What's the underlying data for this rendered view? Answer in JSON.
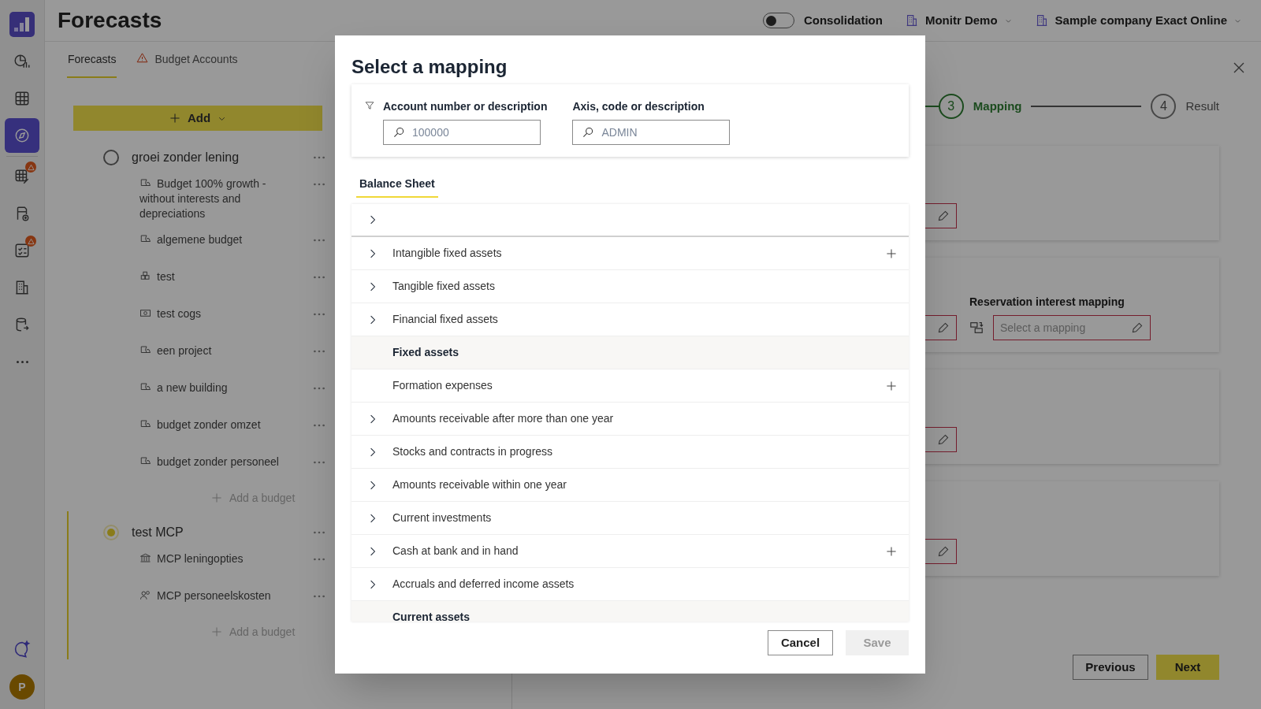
{
  "nav": {
    "items": [
      {
        "kind": "logo",
        "selected": false,
        "badge": false
      },
      {
        "kind": "chart",
        "selected": false,
        "badge": false
      },
      {
        "kind": "grid",
        "selected": false,
        "badge": false
      },
      {
        "kind": "compass",
        "selected": true,
        "badge": false
      },
      {
        "kind": "grid-edit",
        "selected": false,
        "badge": true
      },
      {
        "kind": "doc-add",
        "selected": false,
        "badge": false
      },
      {
        "kind": "checklist",
        "selected": false,
        "badge": true
      },
      {
        "kind": "building",
        "selected": false,
        "badge": false
      },
      {
        "kind": "database",
        "selected": false,
        "badge": false
      },
      {
        "kind": "more",
        "selected": false,
        "badge": false
      }
    ],
    "chat": true,
    "avatar": "P"
  },
  "page_title": "Forecasts",
  "header": {
    "consolidation": {
      "label": "Consolidation",
      "on": false
    },
    "environment": "Monitr Demo",
    "company": "Sample company Exact Online"
  },
  "tabs": [
    {
      "label": "Forecasts",
      "selected": true,
      "warning": false
    },
    {
      "label": "Budget Accounts",
      "selected": false,
      "warning": true
    }
  ],
  "add_button": "Add",
  "scenarios": [
    {
      "name": "groei zonder lening",
      "selected": false,
      "budgets": [
        {
          "name": "Budget 100% growth - without interests and depreciations",
          "kind": "scenario"
        },
        {
          "name": "algemene budget",
          "kind": "scenario"
        },
        {
          "name": "test",
          "kind": "blocks"
        },
        {
          "name": "test cogs",
          "kind": "cash"
        },
        {
          "name": "een project",
          "kind": "scenario"
        },
        {
          "name": "a new building",
          "kind": "scenario"
        },
        {
          "name": "budget zonder omzet",
          "kind": "scenario"
        },
        {
          "name": "budget zonder personeel",
          "kind": "scenario"
        }
      ],
      "add_label": "Add a budget"
    },
    {
      "name": "test MCP",
      "selected": true,
      "budgets": [
        {
          "name": "MCP leningopties",
          "kind": "bank"
        },
        {
          "name": "MCP personeelskosten",
          "kind": "people"
        }
      ],
      "add_label": "Add a budget"
    }
  ],
  "wizard": {
    "steps": [
      {
        "number": "3",
        "label": "Mapping",
        "active": true
      },
      {
        "number": "4",
        "label": "Result",
        "active": false
      }
    ],
    "cards": [
      {
        "kind": "single"
      },
      {
        "kind": "double",
        "label": "Reservation interest mapping",
        "placeholder": "Select a mapping"
      },
      {
        "kind": "single"
      },
      {
        "kind": "single"
      }
    ],
    "previous": "Previous",
    "next": "Next"
  },
  "dialog": {
    "title": "Select a mapping",
    "filters": [
      {
        "label": "Account number or description",
        "placeholder": "100000"
      },
      {
        "label": "Axis, code or description",
        "placeholder": "ADMIN"
      }
    ],
    "tabs": [
      {
        "label": "Balance Sheet",
        "selected": true
      }
    ],
    "rows": [
      {
        "kind": "group",
        "addable": false
      },
      {
        "kind": "group",
        "label": "Intangible fixed assets",
        "addable": true
      },
      {
        "kind": "group",
        "label": "Tangible fixed assets",
        "addable": false
      },
      {
        "kind": "group",
        "label": "Financial fixed assets",
        "addable": false
      },
      {
        "kind": "total",
        "label": "Fixed assets",
        "addable": false
      },
      {
        "kind": "leaf",
        "label": "Formation expenses",
        "addable": true
      },
      {
        "kind": "group",
        "label": "Amounts receivable after more than one year",
        "addable": false
      },
      {
        "kind": "group",
        "label": "Stocks and contracts in progress",
        "addable": false
      },
      {
        "kind": "group",
        "label": "Amounts receivable within one year",
        "addable": false
      },
      {
        "kind": "group",
        "label": "Current investments",
        "addable": false
      },
      {
        "kind": "group",
        "label": "Cash at bank and in hand",
        "addable": true
      },
      {
        "kind": "group",
        "label": "Accruals and deferred income assets",
        "addable": false
      },
      {
        "kind": "total",
        "label": "Current assets",
        "addable": false
      }
    ],
    "cancel": "Cancel",
    "save": {
      "label": "Save",
      "disabled": true
    }
  }
}
